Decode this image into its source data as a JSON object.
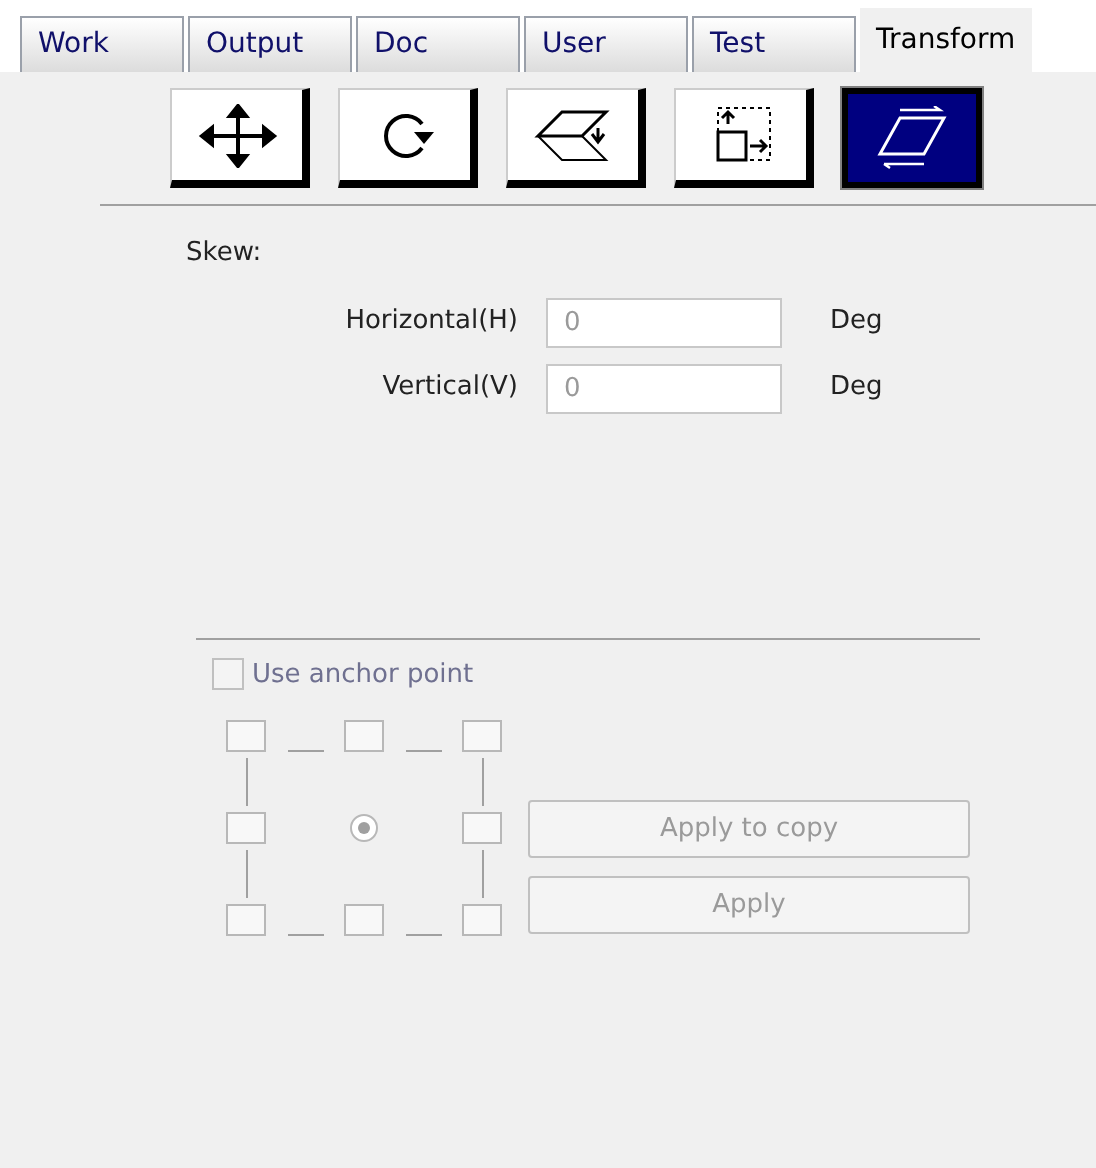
{
  "tabs": [
    {
      "label": "Work",
      "selected": false
    },
    {
      "label": "Output",
      "selected": false
    },
    {
      "label": "Doc",
      "selected": false
    },
    {
      "label": "User",
      "selected": false
    },
    {
      "label": "Test",
      "selected": false
    },
    {
      "label": "Transform",
      "selected": true
    }
  ],
  "tools": [
    {
      "kind": "move",
      "selected": false
    },
    {
      "kind": "rotate",
      "selected": false
    },
    {
      "kind": "mirror",
      "selected": false
    },
    {
      "kind": "scale",
      "selected": false
    },
    {
      "kind": "skew",
      "selected": true
    }
  ],
  "section_title": "Skew:",
  "fields": [
    {
      "label": "Horizontal(H)",
      "value": "0",
      "unit": "Deg"
    },
    {
      "label": "Vertical(V)",
      "value": "0",
      "unit": "Deg"
    }
  ],
  "anchor": {
    "label": "Use anchor point",
    "checked": false,
    "disabled": true,
    "points": [
      {
        "kind": "box",
        "selected": false
      },
      {
        "kind": "box",
        "selected": false
      },
      {
        "kind": "box",
        "selected": false
      },
      {
        "kind": "box",
        "selected": false
      },
      {
        "kind": "radio",
        "selected": true
      },
      {
        "kind": "box",
        "selected": false
      },
      {
        "kind": "box",
        "selected": false
      },
      {
        "kind": "box",
        "selected": false
      },
      {
        "kind": "box",
        "selected": false
      }
    ]
  },
  "buttons": [
    {
      "label": "Apply to copy",
      "disabled": true
    },
    {
      "label": "Apply",
      "disabled": true
    }
  ]
}
